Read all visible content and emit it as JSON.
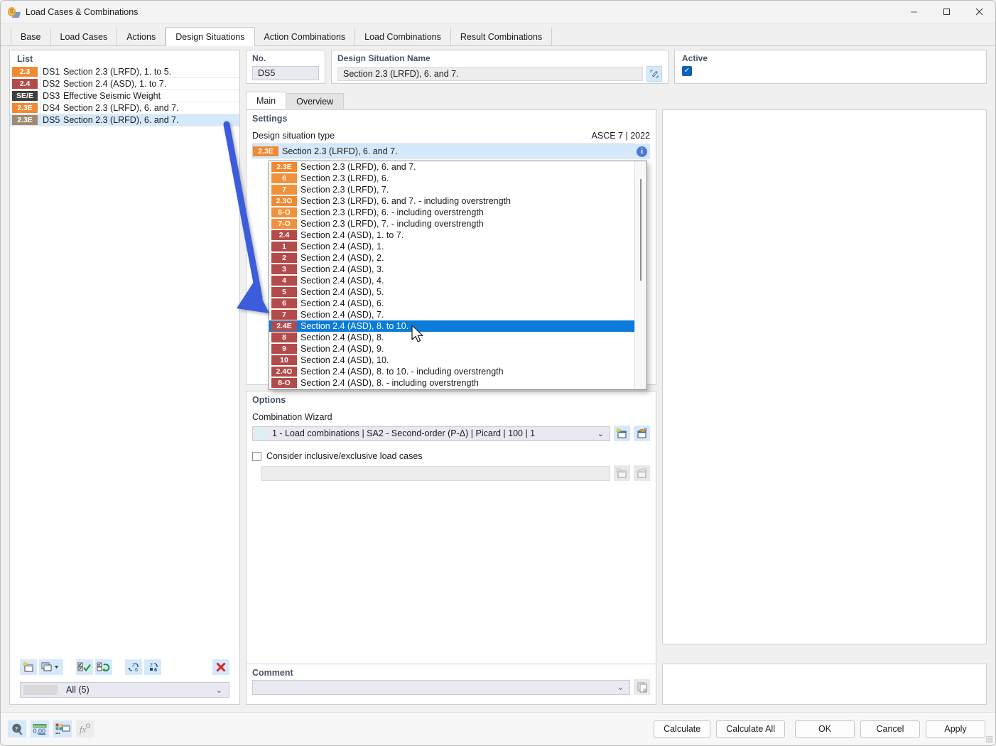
{
  "window": {
    "title": "Load Cases & Combinations",
    "icon": "load-cases-icon",
    "minimize": "–",
    "maximize": "□",
    "close": "✕"
  },
  "tabs": [
    {
      "label": "Base",
      "active": false
    },
    {
      "label": "Load Cases",
      "active": false
    },
    {
      "label": "Actions",
      "active": false
    },
    {
      "label": "Design Situations",
      "active": true
    },
    {
      "label": "Action Combinations",
      "active": false
    },
    {
      "label": "Load Combinations",
      "active": false
    },
    {
      "label": "Result Combinations",
      "active": false
    }
  ],
  "list_panel": {
    "header": "List",
    "rows": [
      {
        "badge": "2.3",
        "badge_color": "#ef8a33",
        "no": "DS1",
        "name": "Section 2.3 (LRFD), 1. to 5.",
        "selected": false
      },
      {
        "badge": "2.4",
        "badge_color": "#b44b4b",
        "no": "DS2",
        "name": "Section 2.4 (ASD), 1. to 7.",
        "selected": false
      },
      {
        "badge": "SE/E",
        "badge_color": "#3f3f3f",
        "no": "DS3",
        "name": "Effective Seismic Weight",
        "selected": false
      },
      {
        "badge": "2.3E",
        "badge_color": "#ef8a33",
        "no": "DS4",
        "name": "Section 2.3 (LRFD), 6. and 7.",
        "selected": false
      },
      {
        "badge": "2.3E",
        "badge_color": "#a08a74",
        "no": "DS5",
        "name": "Section 2.3 (LRFD), 6. and 7.",
        "selected": true
      }
    ],
    "toolbar": [
      {
        "icon": "new-item-icon",
        "label": "New"
      },
      {
        "icon": "copy-item-icon",
        "label": "Copy"
      },
      {
        "icon": "dropdown-caret-icon",
        "label": "More"
      },
      {
        "icon": "select-all-icon",
        "label": "Select All"
      },
      {
        "icon": "invert-selection-icon",
        "label": "Invert Selection"
      },
      {
        "icon": "renumber-icon",
        "label": "Renumber"
      },
      {
        "icon": "renumber-fixed-icon",
        "label": "Renumber Fixed"
      },
      {
        "icon": "delete-icon",
        "label": "Delete"
      }
    ],
    "filter": {
      "value": "All (5)",
      "caret": "⌄"
    }
  },
  "details": {
    "no": {
      "label": "No.",
      "value": "DS5"
    },
    "name": {
      "label": "Design Situation Name",
      "value": "Section 2.3 (LRFD), 6. and 7.",
      "edit_icon": "edit-pencil-icon"
    },
    "active": {
      "label": "Active",
      "checked": true,
      "check_glyph": "✓"
    },
    "inner_tabs": [
      {
        "label": "Main",
        "active": true
      },
      {
        "label": "Overview",
        "active": false
      }
    ]
  },
  "settings": {
    "title": "Settings",
    "type_label": "Design situation type",
    "standard": "ASCE 7 | 2022",
    "selected_badge": "2.3E",
    "selected_badge_color": "#ef8a33",
    "selected_text": "Section 2.3 (LRFD), 6. and 7.",
    "caret": "⌄",
    "info_icon": "info-icon",
    "info_glyph": "i"
  },
  "dropdown": {
    "items": [
      {
        "badge": "2.3E",
        "color": "#ef8a33",
        "text": "Section 2.3 (LRFD), 6. and 7.",
        "highlighted": false
      },
      {
        "badge": "6",
        "color": "#f0913c",
        "text": "Section 2.3 (LRFD), 6.",
        "highlighted": false
      },
      {
        "badge": "7",
        "color": "#f0913c",
        "text": "Section 2.3 (LRFD), 7.",
        "highlighted": false
      },
      {
        "badge": "2.3O",
        "color": "#ef8a33",
        "text": "Section 2.3 (LRFD), 6. and 7. - including overstrength",
        "highlighted": false
      },
      {
        "badge": "6-O",
        "color": "#f0913c",
        "text": "Section 2.3 (LRFD), 6. - including overstrength",
        "highlighted": false
      },
      {
        "badge": "7-O",
        "color": "#f0913c",
        "text": "Section 2.3 (LRFD), 7. - including overstrength",
        "highlighted": false
      },
      {
        "badge": "2.4",
        "color": "#b44b4b",
        "text": "Section 2.4 (ASD), 1. to 7.",
        "highlighted": false
      },
      {
        "badge": "1",
        "color": "#b44b4b",
        "text": "Section 2.4 (ASD), 1.",
        "highlighted": false
      },
      {
        "badge": "2",
        "color": "#b44b4b",
        "text": "Section 2.4 (ASD), 2.",
        "highlighted": false
      },
      {
        "badge": "3",
        "color": "#b44b4b",
        "text": "Section 2.4 (ASD), 3.",
        "highlighted": false
      },
      {
        "badge": "4",
        "color": "#b44b4b",
        "text": "Section 2.4 (ASD), 4.",
        "highlighted": false
      },
      {
        "badge": "5",
        "color": "#b44b4b",
        "text": "Section 2.4 (ASD), 5.",
        "highlighted": false
      },
      {
        "badge": "6",
        "color": "#b44b4b",
        "text": "Section 2.4 (ASD), 6.",
        "highlighted": false
      },
      {
        "badge": "7",
        "color": "#b44b4b",
        "text": "Section 2.4 (ASD), 7.",
        "highlighted": false
      },
      {
        "badge": "2.4E",
        "color": "#b44b4b",
        "text": "Section 2.4 (ASD), 8. to 10.",
        "highlighted": true
      },
      {
        "badge": "8",
        "color": "#b44b4b",
        "text": "Section 2.4 (ASD), 8.",
        "highlighted": false
      },
      {
        "badge": "9",
        "color": "#b44b4b",
        "text": "Section 2.4 (ASD), 9.",
        "highlighted": false
      },
      {
        "badge": "10",
        "color": "#b44b4b",
        "text": "Section 2.4 (ASD), 10.",
        "highlighted": false
      },
      {
        "badge": "2.4O",
        "color": "#b44b4b",
        "text": "Section 2.4 (ASD), 8. to 10. - including overstrength",
        "highlighted": false
      },
      {
        "badge": "8-O",
        "color": "#b44b4b",
        "text": "Section 2.4 (ASD), 8. - including overstrength",
        "highlighted": false
      }
    ]
  },
  "options": {
    "title": "Options",
    "wizard_label": "Combination Wizard",
    "wizard_value": "1 - Load combinations | SA2 - Second-order (P-Δ) | Picard | 100 | 1",
    "wizard_caret": "⌄",
    "wizard_new_icon": "new-wizard-icon",
    "wizard_edit_icon": "edit-wizard-icon",
    "checkbox_label": "Consider inclusive/exclusive load cases",
    "checkbox_checked": false,
    "incl_new_icon": "new-inclusive-icon",
    "incl_edit_icon": "edit-inclusive-icon"
  },
  "comment": {
    "label": "Comment",
    "value": "",
    "caret": "⌄",
    "copy_icon": "copy-comment-icon"
  },
  "bottom": {
    "left_icons": [
      {
        "icon": "help-icon",
        "enabled": true
      },
      {
        "icon": "units-icon",
        "enabled": true
      },
      {
        "icon": "display-properties-icon",
        "enabled": true
      },
      {
        "icon": "formula-icon",
        "enabled": false
      }
    ],
    "buttons": [
      {
        "label": "Calculate"
      },
      {
        "label": "Calculate All"
      },
      {
        "label": "OK"
      },
      {
        "label": "Cancel"
      },
      {
        "label": "Apply"
      }
    ]
  },
  "annotation": {
    "arrow_color": "#3b5bdb",
    "name": "pointer-arrow"
  }
}
